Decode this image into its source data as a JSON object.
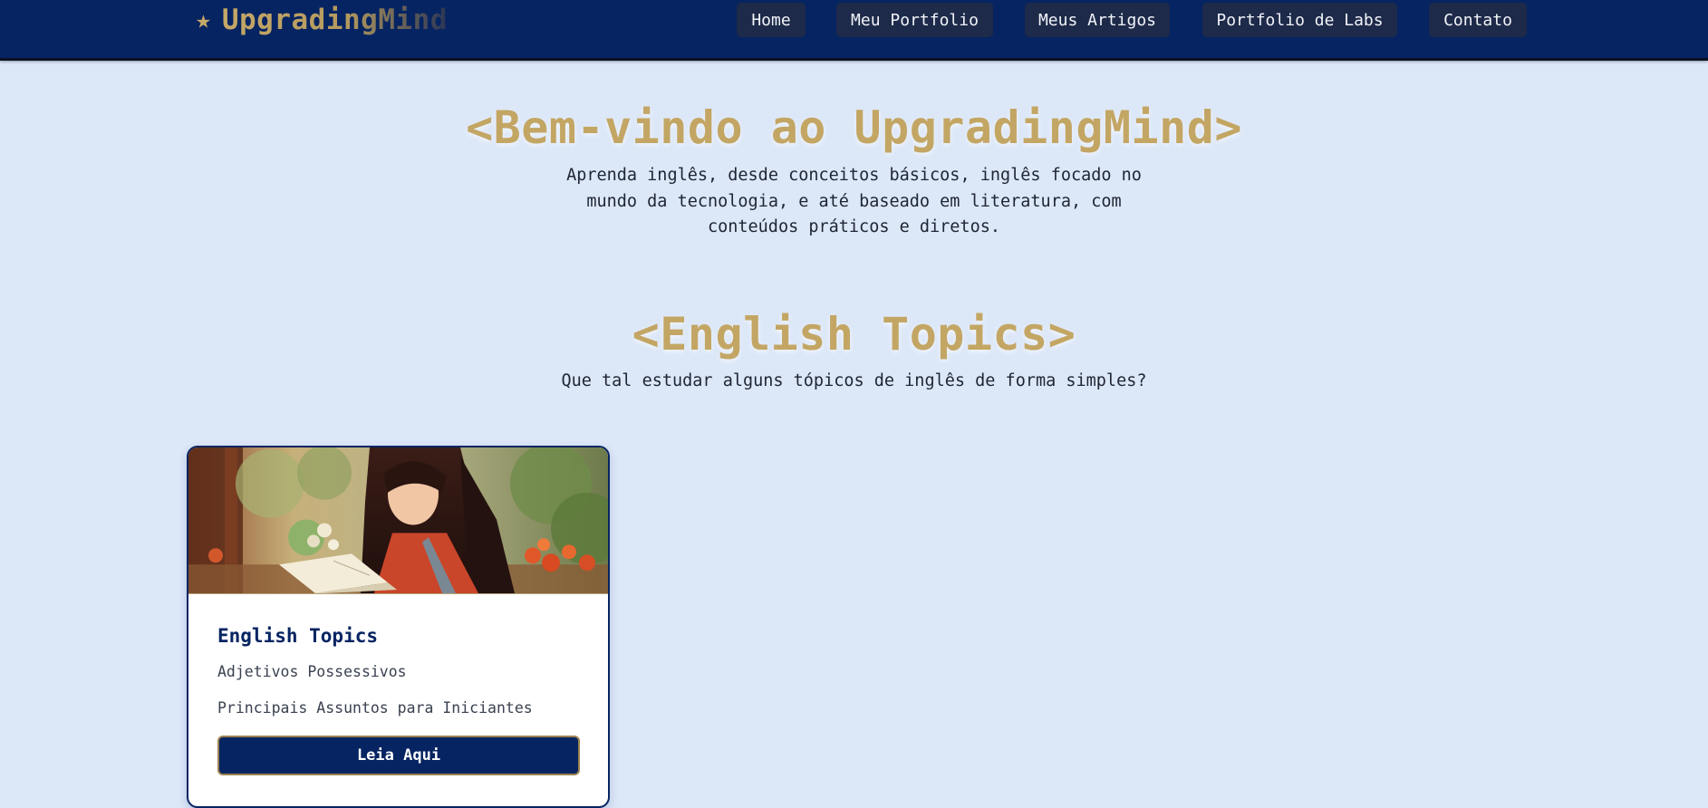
{
  "header": {
    "brand_star": "★",
    "brand_name": "UpgradingMind",
    "nav": [
      {
        "label": "Home"
      },
      {
        "label": "Meu Portfolio"
      },
      {
        "label": "Meus Artigos"
      },
      {
        "label": "Portfolio de Labs"
      },
      {
        "label": "Contato"
      }
    ]
  },
  "hero": {
    "title": "<Bem-vindo ao UpgradingMind>",
    "subtitle": "Aprenda inglês, desde conceitos básicos, inglês focado no mundo da tecnologia, e até baseado em literatura, com conteúdos práticos e diretos."
  },
  "topics": {
    "title": "<English Topics>",
    "subtitle": "Que tal estudar alguns tópicos de inglês de forma simples?"
  },
  "card": {
    "title": "English Topics",
    "items": [
      {
        "label": "Adjetivos Possessivos"
      },
      {
        "label": "Principais Assuntos para Iniciantes"
      }
    ],
    "button_label": "Leia Aqui"
  },
  "colors": {
    "navy": "#062462",
    "gold": "#c3a664",
    "page_bg": "#dce7f8",
    "nav_button_bg": "#1d2a49"
  }
}
